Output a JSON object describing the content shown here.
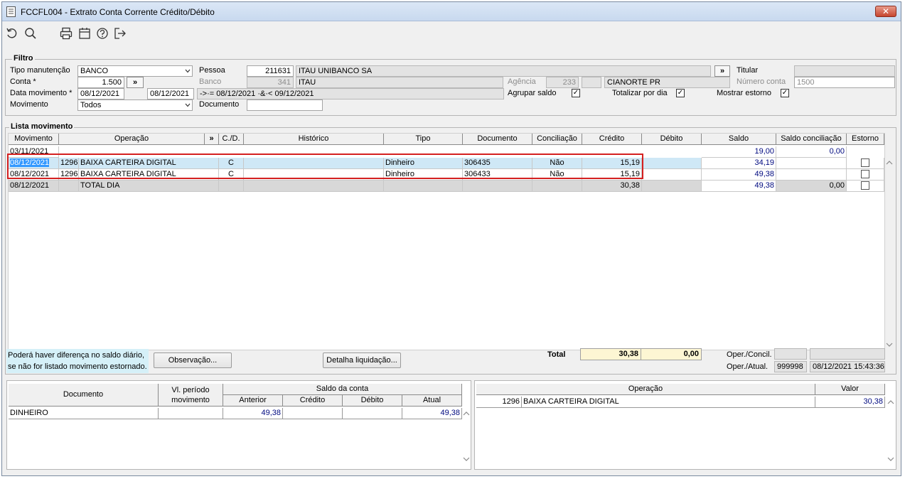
{
  "window": {
    "title": "FCCFL004 - Extrato Conta Corrente Crédito/Débito",
    "close_label": "✕"
  },
  "toolbar": {
    "icons": [
      "undo-icon",
      "search-icon",
      "print-icon",
      "calendar-icon",
      "help-icon",
      "exit-icon"
    ]
  },
  "filtro": {
    "legend": "Filtro",
    "tipo_manutencao_label": "Tipo manutenção",
    "tipo_manutencao_value": "BANCO",
    "conta_label": "Conta *",
    "conta_value": "1.500",
    "conta_btn": "»",
    "data_movimento_label": "Data movimento *",
    "data_inicio": "08/12/2021",
    "data_fim": "08/12/2021",
    "data_expr": "->·= 08/12/2021 ·&·< 09/12/2021",
    "movimento_label": "Movimento",
    "movimento_value": "Todos",
    "pessoa_label": "Pessoa",
    "pessoa_code": "211631",
    "pessoa_name": "ITAU UNIBANCO SA",
    "pessoa_btn": "»",
    "banco_label": "Banco",
    "banco_code": "341",
    "banco_name": "ITAU",
    "documento_label": "Documento",
    "documento_value": "",
    "agencia_label": "Agência",
    "agencia_code": "233",
    "agencia_city": "CIANORTE PR",
    "agrupar_saldo_label": "Agrupar saldo",
    "totalizar_label": "Totalizar por dia",
    "mostrar_estorno_label": "Mostrar estorno",
    "titular_label": "Titular",
    "titular_value": "",
    "numero_conta_label": "Número conta",
    "numero_conta_value": "1500",
    "check_mark": "✓"
  },
  "lista": {
    "legend": "Lista movimento",
    "headers": {
      "movimento": "Movimento",
      "operacao": "Operação",
      "more": "»",
      "cd": "C./D.",
      "historico": "Histórico",
      "tipo": "Tipo",
      "documento": "Documento",
      "conciliacao": "Conciliação",
      "credito": "Crédito",
      "debito": "Débito",
      "saldo": "Saldo",
      "saldo_conciliacao": "Saldo conciliação",
      "estorno": "Estorno"
    },
    "rows": [
      {
        "movimento": "03/11/2021",
        "op_code": "",
        "operacao": "",
        "cd": "",
        "historico": "",
        "tipo": "",
        "documento": "",
        "conciliacao": "",
        "credito": "",
        "debito": "",
        "saldo": "19,00",
        "saldo_conciliacao": "0,00"
      },
      {
        "movimento": "08/12/2021",
        "op_code": "1296",
        "operacao": "BAIXA CARTEIRA DIGITAL",
        "cd": "C",
        "historico": "",
        "tipo": "Dinheiro",
        "documento": "306435",
        "conciliacao": "Não",
        "credito": "15,19",
        "debito": "",
        "saldo": "34,19",
        "saldo_conciliacao": ""
      },
      {
        "movimento": "08/12/2021",
        "op_code": "1296",
        "operacao": "BAIXA CARTEIRA DIGITAL",
        "cd": "C",
        "historico": "",
        "tipo": "Dinheiro",
        "documento": "306433",
        "conciliacao": "Não",
        "credito": "15,19",
        "debito": "",
        "saldo": "49,38",
        "saldo_conciliacao": ""
      },
      {
        "movimento": "08/12/2021",
        "op_code": "",
        "operacao": "TOTAL DIA",
        "cd": "",
        "historico": "",
        "tipo": "",
        "documento": "",
        "conciliacao": "",
        "credito": "30,38",
        "debito": "",
        "saldo": "49,38",
        "saldo_conciliacao": "0,00"
      }
    ]
  },
  "footer": {
    "notice_line1": "Poderá haver diferença no saldo diário,",
    "notice_line2": "se não for listado movimento estornado.",
    "observacao_btn": "Observação...",
    "detalha_btn": "Detalha liquidação...",
    "total_label": "Total",
    "total_credito": "30,38",
    "total_debito": "0,00",
    "oper_concil_label": "Oper./Concil.",
    "oper_concil_code": "",
    "oper_concil_date": "",
    "oper_atual_label": "Oper./Atual.",
    "oper_atual_code": "999998",
    "oper_atual_date": "08/12/2021 15:43:36"
  },
  "bottom_left": {
    "headers": {
      "documento": "Documento",
      "vl_periodo_1": "Vl. período",
      "vl_periodo_2": "movimento",
      "saldo_conta": "Saldo da conta",
      "anterior": "Anterior",
      "credito": "Crédito",
      "debito": "Débito",
      "atual": "Atual"
    },
    "rows": [
      {
        "documento": "DINHEIRO",
        "vl_periodo": "",
        "anterior": "49,38",
        "credito": "",
        "debito": "",
        "atual": "49,38"
      }
    ]
  },
  "bottom_right": {
    "headers": {
      "operacao": "Operação",
      "valor": "Valor"
    },
    "rows": [
      {
        "code": "1296",
        "operacao": "BAIXA CARTEIRA DIGITAL",
        "valor": "30,38"
      }
    ]
  }
}
